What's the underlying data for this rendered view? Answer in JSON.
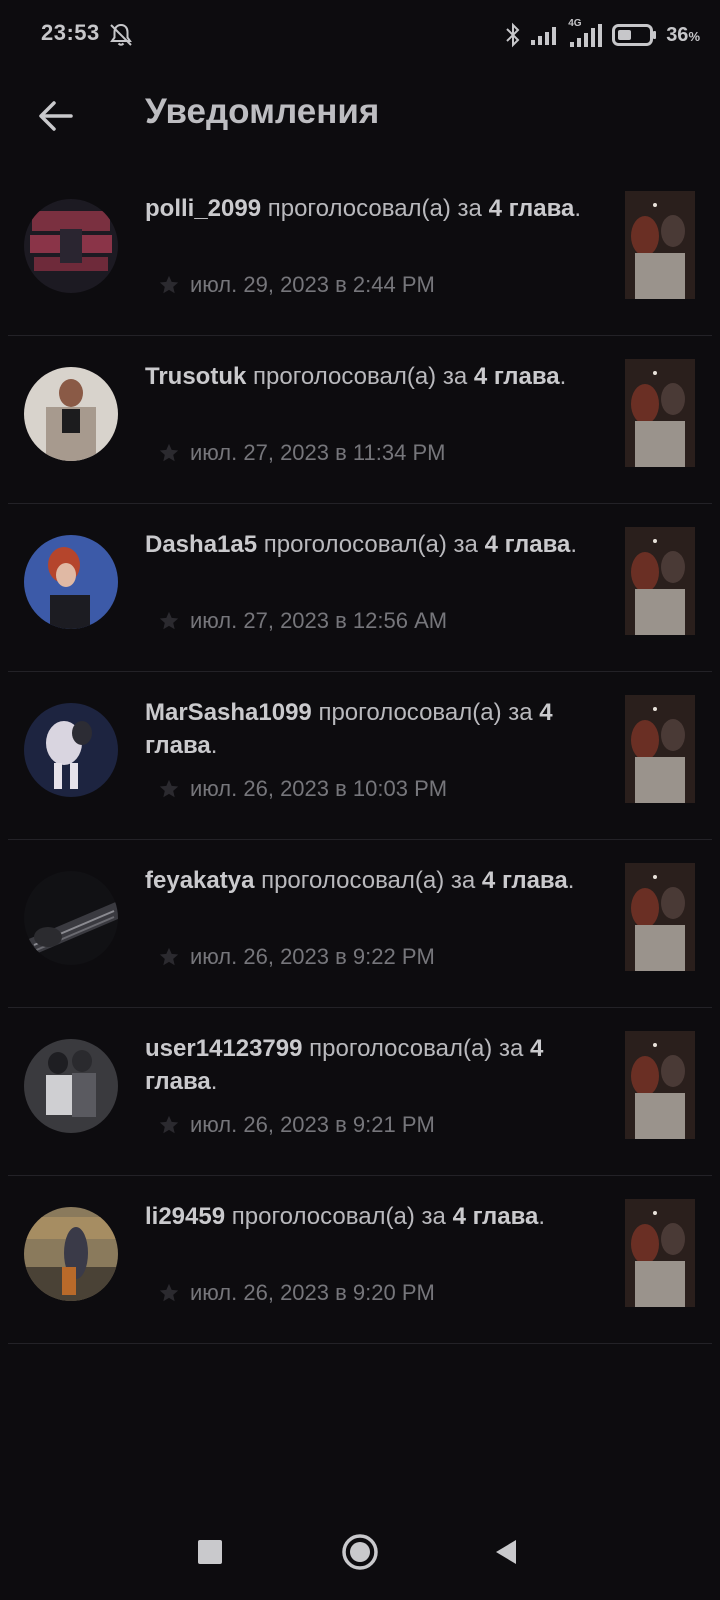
{
  "status_bar": {
    "time": "23:53",
    "network_label": "4G",
    "battery_percent": "36",
    "battery_unit": "%",
    "icons": [
      "bell-muted-icon",
      "bluetooth-icon",
      "signal-icon",
      "signal-4g-icon",
      "battery-icon"
    ]
  },
  "header": {
    "title": "Уведомления",
    "back_icon": "arrow-left-icon"
  },
  "notifications": [
    {
      "user": "polli_2099",
      "action": " проголосовал(а) за ",
      "chapter": "4 глава",
      "end": ".",
      "time": "июл. 29, 2023 в 2:44 PM"
    },
    {
      "user": "Trusotuk",
      "action": " проголосовал(а) за ",
      "chapter": "4 глава",
      "end": ".",
      "time": "июл. 27, 2023 в 11:34 PM"
    },
    {
      "user": "Dasha1a5",
      "action": " проголосовал(а) за ",
      "chapter": "4 глава",
      "end": ".",
      "time": "июл. 27, 2023 в 12:56 AM"
    },
    {
      "user": "MarSasha1099",
      "action": " проголосовал(а) за ",
      "chapter": "4 глава",
      "end": ".",
      "time": "июл. 26, 2023 в 10:03 PM"
    },
    {
      "user": "feyakatya",
      "action": " проголосовал(а) за ",
      "chapter": "4 глава",
      "end": ".",
      "time": "июл. 26, 2023 в 9:22 PM"
    },
    {
      "user": "user14123799",
      "action": " проголосовал(а) за ",
      "chapter": "4 глава",
      "end": ".",
      "time": "июл. 26, 2023 в 9:21 PM"
    },
    {
      "user": "li29459",
      "action": " проголосовал(а) за ",
      "chapter": "4 глава",
      "end": ".",
      "time": "июл. 26, 2023 в 9:20 PM"
    }
  ],
  "avatar_colors": [
    "#7a3040",
    "#a79a8e",
    "#3c5aa8",
    "#1d2440",
    "#2b2b2f",
    "#5a5a60",
    "#8a7a5c"
  ],
  "nav_bar": {
    "icons": [
      "recents-square-icon",
      "home-circle-icon",
      "back-triangle-icon"
    ]
  },
  "colors": {
    "background": "#0d0c0f",
    "text": "#c9c9cc",
    "meta_text": "#76767b",
    "divider": "#232227"
  }
}
